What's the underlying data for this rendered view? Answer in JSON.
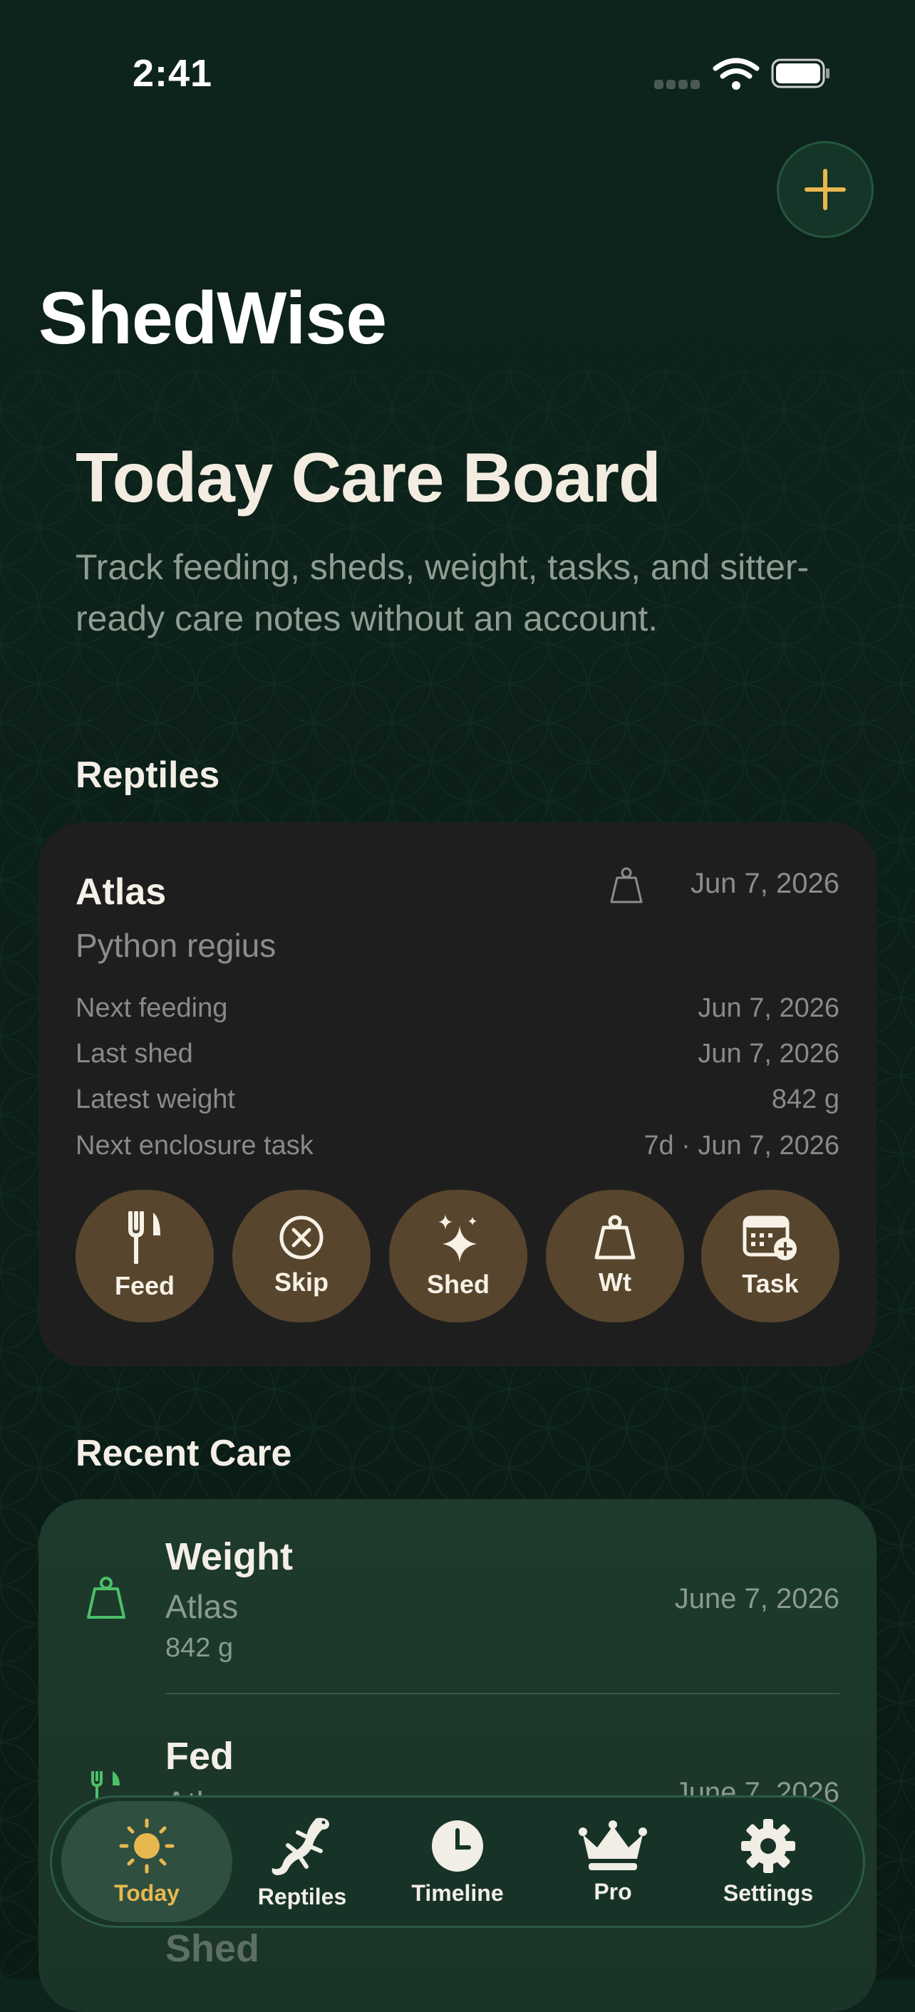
{
  "status_bar": {
    "time": "2:41"
  },
  "app_title": "ShedWise",
  "hero": {
    "title": "Today Care Board",
    "subtitle": "Track feeding, sheds, weight, tasks, and sitter-ready care notes without an account."
  },
  "reptiles_section": {
    "heading": "Reptiles",
    "card": {
      "name": "Atlas",
      "species": "Python regius",
      "date": "Jun 7, 2026",
      "rows": [
        {
          "label": "Next feeding",
          "value": "Jun 7, 2026"
        },
        {
          "label": "Last shed",
          "value": "Jun 7, 2026"
        },
        {
          "label": "Latest weight",
          "value": "842 g"
        },
        {
          "label": "Next enclosure task",
          "value": "7d · Jun 7, 2026"
        }
      ],
      "actions": [
        {
          "label": "Feed",
          "icon": "fork-knife-icon"
        },
        {
          "label": "Skip",
          "icon": "x-circle-icon"
        },
        {
          "label": "Shed",
          "icon": "sparkles-icon"
        },
        {
          "label": "Wt",
          "icon": "scale-icon"
        },
        {
          "label": "Task",
          "icon": "calendar-plus-icon"
        }
      ]
    }
  },
  "recent_section": {
    "heading": "Recent Care",
    "entries": [
      {
        "title": "Weight",
        "reptile": "Atlas",
        "detail": "842 g",
        "date": "June 7, 2026",
        "icon": "scale-icon"
      },
      {
        "title": "Fed",
        "reptile": "Atlas",
        "date": "June 7, 2026",
        "icon": "fork-knife-icon"
      },
      {
        "title": "Shed",
        "icon": "sparkles-icon"
      }
    ]
  },
  "tab_bar": {
    "tabs": [
      {
        "label": "Today",
        "icon": "sun-icon",
        "active": true
      },
      {
        "label": "Reptiles",
        "icon": "lizard-icon"
      },
      {
        "label": "Timeline",
        "icon": "clock-icon"
      },
      {
        "label": "Pro",
        "icon": "crown-icon"
      },
      {
        "label": "Settings",
        "icon": "gear-icon"
      }
    ]
  },
  "colors": {
    "accent": "#e8b850",
    "action_button": "#57462d",
    "card": "#1f1e1f",
    "background": "#0d241c",
    "recent_icon": "#4cc06a"
  }
}
